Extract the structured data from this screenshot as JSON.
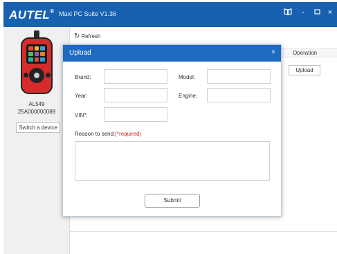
{
  "titlebar": {
    "brand": "AUTEL",
    "brand_mark": "®",
    "app_title": "Maxi PC Suite V1.36",
    "controls": {
      "book_icon": "book-icon",
      "minimize": "-",
      "maximize": "▫",
      "close": "×"
    }
  },
  "sidebar": {
    "model": "AL549",
    "serial": "25A000000089",
    "switch_label": "Switch a device",
    "device_colors": {
      "body": "#d62b2b",
      "screen": "#1b1b1b"
    }
  },
  "main": {
    "refresh_label": "Refresh",
    "operation_header": "Operation",
    "row_upload_label": "Upload"
  },
  "modal": {
    "title": "Upload",
    "close_label": "×",
    "brand_label": "Brand:",
    "model_label": "Model:",
    "year_label": "Year:",
    "engine_label": "Engine:",
    "vin_label": "VIN*:",
    "reason_label": "Reason to send:",
    "reason_required": "(*required)",
    "fields": {
      "brand": "",
      "model": "",
      "year": "",
      "engine": "",
      "vin": "",
      "reason": ""
    },
    "submit_label": "Submit"
  },
  "colors": {
    "titlebar": "#1861b0",
    "modal_header": "#1e6ac0",
    "required": "#e02424"
  }
}
